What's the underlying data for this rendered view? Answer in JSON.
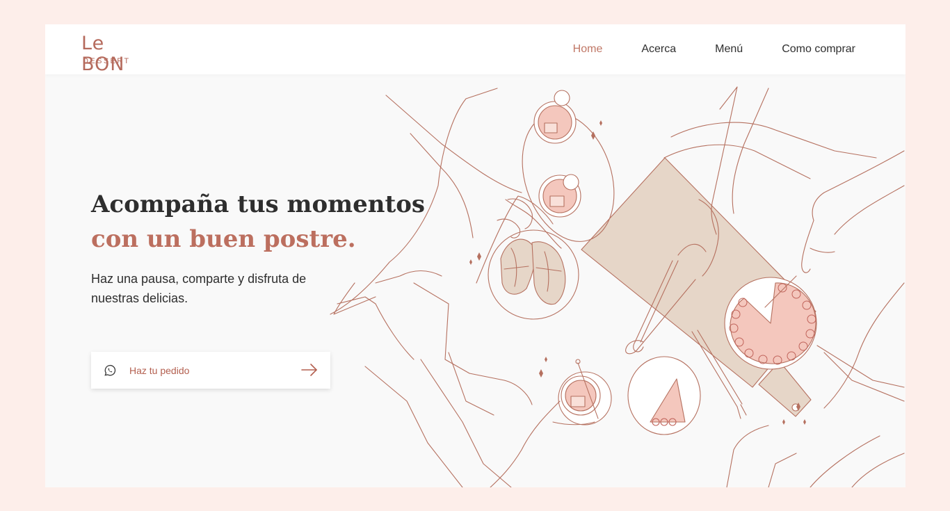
{
  "brand": {
    "logo_script": "Le BON",
    "logo_sub": "DESSERT"
  },
  "nav": {
    "items": [
      {
        "label": "Home",
        "active": true
      },
      {
        "label": "Acerca",
        "active": false
      },
      {
        "label": "Menú",
        "active": false
      },
      {
        "label": "Como comprar",
        "active": false
      }
    ]
  },
  "hero": {
    "title_line1": "Acompaña tus momentos",
    "title_line2": "con un buen postre.",
    "subtitle": "Haz una pausa, comparte y disfruta de nuestras delicias.",
    "cta_label": "Haz tu pedido",
    "cta_icon": "whatsapp-icon",
    "cta_arrow_icon": "arrow-right-icon"
  },
  "colors": {
    "page_bg": "#fdeeea",
    "accent": "#bc6f5f",
    "line_art": "#b5705f",
    "board": "#e6d6c8",
    "pink_fill": "#f4c7bd"
  }
}
